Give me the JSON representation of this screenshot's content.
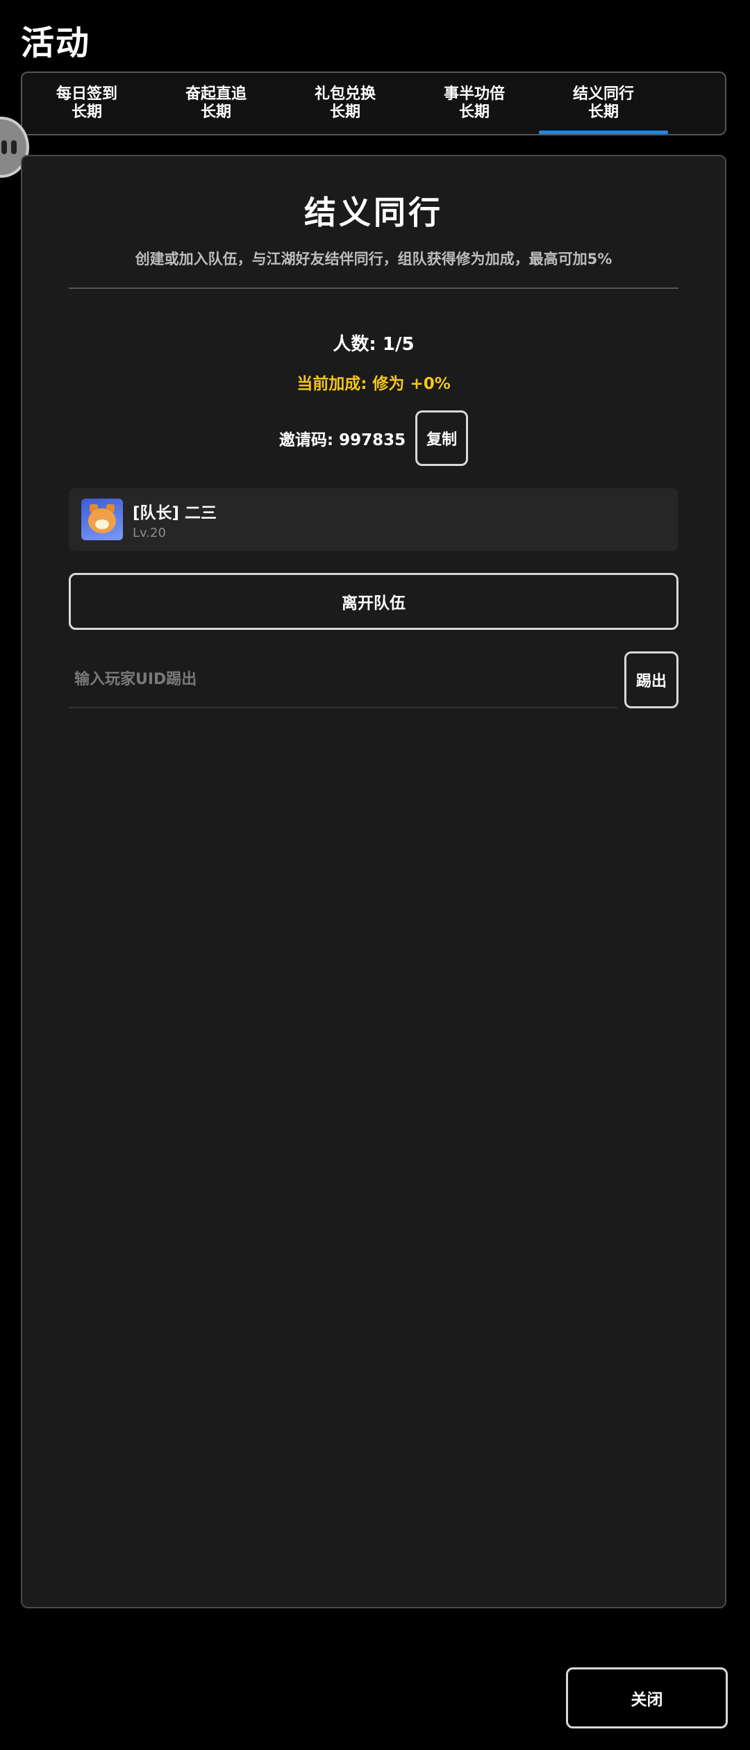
{
  "page": {
    "title": "活动"
  },
  "tabs": [
    {
      "name": "每日签到",
      "sub": "长期"
    },
    {
      "name": "奋起直追",
      "sub": "长期"
    },
    {
      "name": "礼包兑换",
      "sub": "长期"
    },
    {
      "name": "事半功倍",
      "sub": "长期"
    },
    {
      "name": "结义同行",
      "sub": "长期",
      "active": true
    }
  ],
  "panel": {
    "title": "结义同行",
    "description": "创建或加入队伍，与江湖好友结伴同行，组队获得修为加成，最高可加5%",
    "member_count": "人数: 1/5",
    "bonus": "当前加成: 修为 +0%",
    "invite": {
      "label": "邀请码: 997835",
      "copy_label": "复制"
    },
    "members": [
      {
        "name": "[队长] 二三",
        "level": "Lv.20",
        "avatar": "shiba-dog-avatar"
      }
    ],
    "leave_label": "离开队伍",
    "kick": {
      "placeholder": "输入玩家UID踢出",
      "value": "",
      "button_label": "踢出"
    }
  },
  "footer": {
    "close_label": "关闭"
  },
  "colors": {
    "background": "#000000",
    "panel": "#1b1b1b",
    "accent": "#1e88e5",
    "bonus": "#f5c518"
  }
}
